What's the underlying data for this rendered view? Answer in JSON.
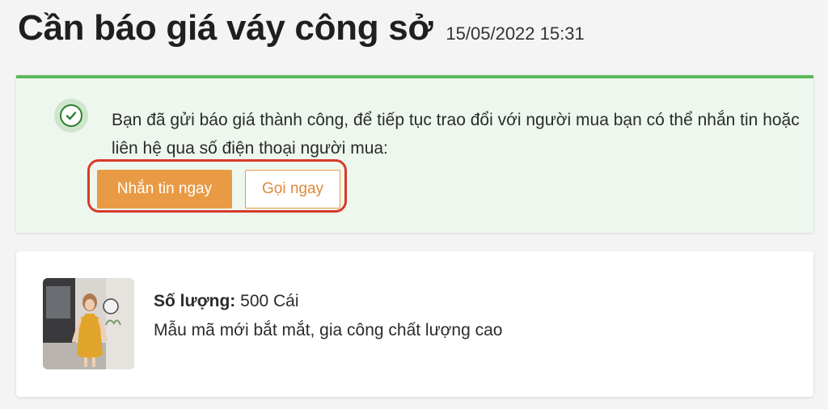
{
  "header": {
    "title": "Cần báo giá váy công sở",
    "datetime": "15/05/2022 15:31"
  },
  "notice": {
    "icon": "check-circle-icon",
    "message": "Bạn đã gửi báo giá thành công, để tiếp tục trao đổi với người mua bạn có thể nhắn tin hoặc liên hệ qua số điện thoại người mua:",
    "message_button": "Nhắn tin ngay",
    "call_button": "Gọi ngay",
    "accent_color": "#5db85a",
    "highlight_color": "#d83a2a"
  },
  "product": {
    "quantity_label": "Số lượng:",
    "quantity_value": "500 Cái",
    "description": "Mẫu mã mới bắt mắt, gia công chất lượng cao",
    "image": "product-photo-yellow-dress"
  },
  "colors": {
    "primary_button": "#e99a44",
    "success": "#2f7d32"
  }
}
